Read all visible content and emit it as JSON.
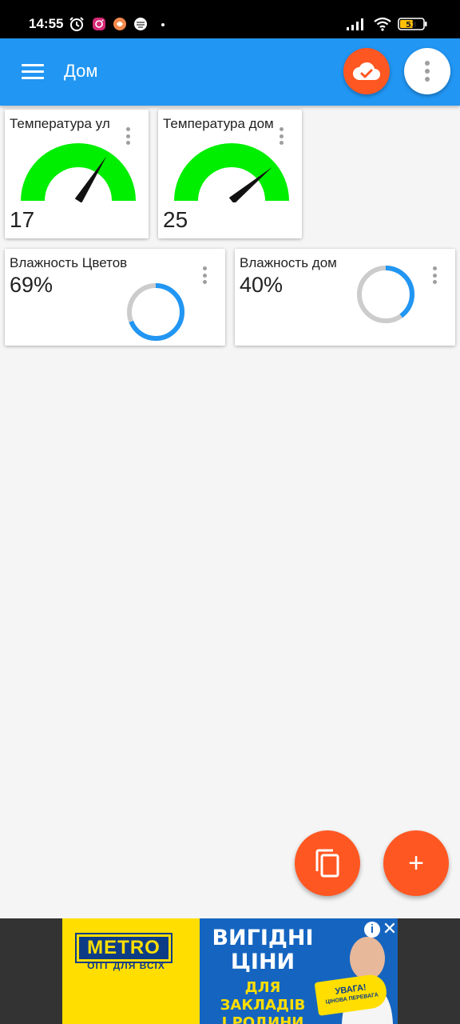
{
  "status_bar": {
    "time": "14:55",
    "battery": "53",
    "icons": [
      "alarm-icon",
      "instagram-icon",
      "app-notification-icon",
      "app-notification-icon",
      "signal-icon",
      "wifi-icon",
      "battery-icon"
    ]
  },
  "app_bar": {
    "title": "Дом",
    "actions": [
      "menu-icon",
      "cloud-done-icon",
      "more-vert-icon"
    ]
  },
  "gauges": [
    {
      "title": "Температура ул",
      "value": "17",
      "fill_fraction": 0.68
    },
    {
      "title": "Температура дом",
      "value": "25",
      "fill_fraction": 0.78
    }
  ],
  "progress_rings": [
    {
      "title": "Влажность Цветов",
      "value": "69%",
      "percent": 69
    },
    {
      "title": "Влажность дом",
      "value": "40%",
      "percent": 40
    }
  ],
  "fabs": {
    "copy": "copy-icon",
    "add": "+"
  },
  "ad": {
    "brand": "METRO",
    "brand_sub": "ОПТ ДЛЯ ВСІХ",
    "headline_line1": "ВИГІДНІ",
    "headline_line2": "ЦІНИ",
    "subline_line1": "ДЛЯ ЗАКЛАДІВ",
    "subline_line2": "І РОДИНИ",
    "megaphone_line1": "УВАГА!",
    "megaphone_line2": "ЦІНОВА ПЕРЕВАГА",
    "info": "i",
    "close": "✕"
  },
  "colors": {
    "primary": "#2196f3",
    "accent": "#ff5722",
    "gauge_fill": "#00ee00",
    "ring_progress": "#2196f3",
    "ring_track": "#cccccc"
  }
}
